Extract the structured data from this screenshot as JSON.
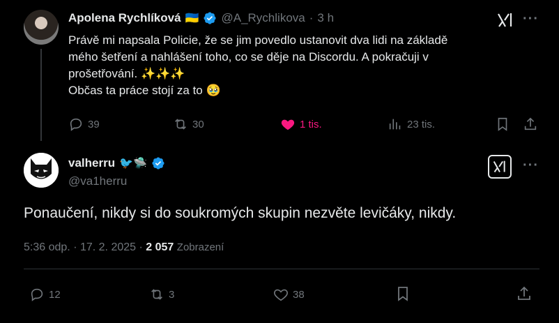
{
  "tweet1": {
    "author_name": "Apolena Rychlíková",
    "flag_emoji": "🇺🇦",
    "handle": "@A_Rychlikova",
    "separator": "·",
    "time": "3 h",
    "text_lines": [
      "Právě mi napsala Policie, že se jim povedlo ustanovit dva lidi na základě",
      "mého šetření a nahlášení toho, co se děje na Discordu. A pokračuji v",
      "prošetřování. ✨✨✨",
      "Občas ta práce stojí za to 🥹"
    ],
    "replies": "39",
    "reposts": "30",
    "likes": "1 tis.",
    "views": "23 tis.",
    "like_color": "#f91880"
  },
  "tweet2": {
    "author_name": "valherru",
    "badges": "🐦🛸",
    "handle": "@va1herru",
    "text": "Ponaučení, nikdy si do soukromých skupin nezvěte levičáky, nikdy.",
    "time": "5:36 odp.",
    "dot": "·",
    "date": "17. 2. 2025",
    "views_count": "2 057",
    "views_label": "Zobrazení",
    "replies": "12",
    "reposts": "3",
    "likes": "38"
  },
  "colors": {
    "accent": "#1d9bf0",
    "muted": "#71767b",
    "text": "#e7e9ea"
  }
}
